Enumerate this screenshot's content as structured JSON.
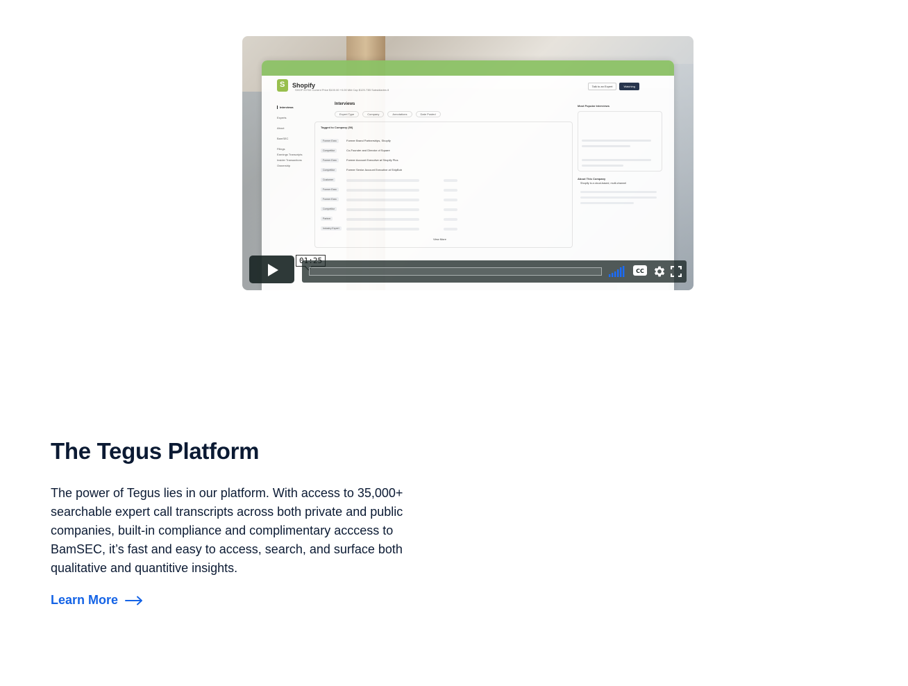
{
  "video": {
    "timestamp": "01:25",
    "screen": {
      "company": "Shopify",
      "ticker_line": "SHOP  NYSE  Current Price $100.00 +0.00  Mkt Cap $125.73B  Subsidiaries 8",
      "talk_button": "Talk to an Expert",
      "watching_button": "Watching",
      "sidebar": [
        "Interviews",
        "Experts",
        "About",
        "BamSEC",
        "Filings",
        "Earnings Transcripts",
        "Insider Transactions",
        "Ownership"
      ],
      "main_title": "Interviews",
      "filters": [
        "Expert Type",
        "Company",
        "Annotations",
        "Date Posted"
      ],
      "table_title": "Tagged to Company (50)",
      "rows": [
        {
          "tag": "Former Exec",
          "title": "Former Brand Partnerships, Shopify"
        },
        {
          "tag": "Competitor",
          "title": "Co-Founder and Director of Square"
        },
        {
          "tag": "Former Exec",
          "title": "Former Account Executive at Shopify Plus"
        },
        {
          "tag": "Competitor",
          "title": "Former Senior Account Executive at ShipBob"
        },
        {
          "tag": "Customer",
          "title": ""
        },
        {
          "tag": "Former Exec",
          "title": ""
        },
        {
          "tag": "Former Exec",
          "title": ""
        },
        {
          "tag": "Competitor",
          "title": ""
        },
        {
          "tag": "Partner",
          "title": ""
        },
        {
          "tag": "Industry Expert",
          "title": ""
        }
      ],
      "view_more": "View More",
      "popular_title": "Most Popular Interviews",
      "about_title": "About This Company",
      "about_text": "Shopify is a cloud-based, multi-channel"
    }
  },
  "section": {
    "title": "The Tegus Platform",
    "body": "The power of Tegus lies in our platform. With access to 35,000+ searchable expert call transcripts across both private and public companies, built-in compliance and complimentary acccess to BamSEC, it’s fast and easy to access, search, and surface both qualitative and quantitive insights.",
    "link_label": "Learn More"
  },
  "colors": {
    "heading": "#0b1a33",
    "link": "#1463e6",
    "player_bg": "#172322",
    "volume": "#1a6cff"
  }
}
